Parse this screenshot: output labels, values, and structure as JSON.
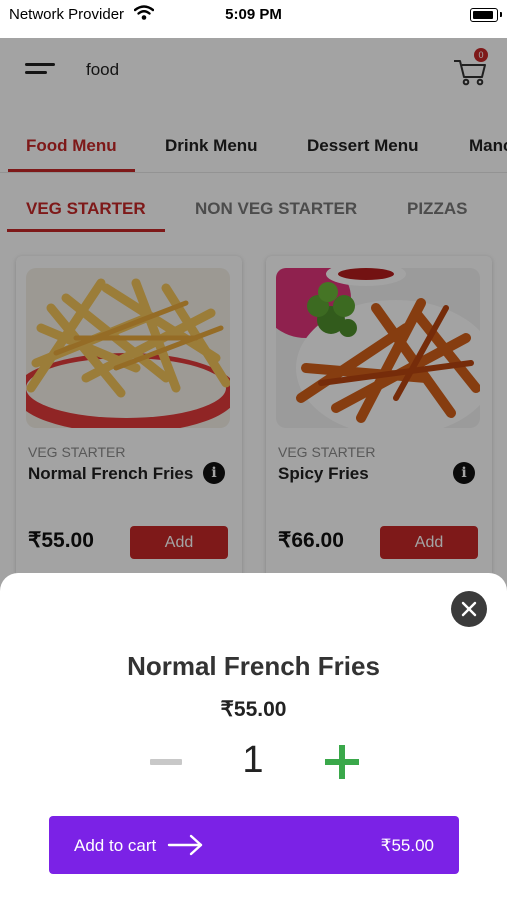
{
  "status_bar": {
    "carrier": "Network Provider",
    "time": "5:09 PM"
  },
  "header": {
    "search_text": "food",
    "cart_count": "0"
  },
  "menu_tabs": [
    {
      "label": "Food Menu",
      "active": true
    },
    {
      "label": "Drink Menu",
      "active": false
    },
    {
      "label": "Dessert Menu",
      "active": false
    },
    {
      "label": "Manc",
      "active": false
    }
  ],
  "category_tabs": [
    {
      "label": "VEG STARTER",
      "active": true
    },
    {
      "label": "NON VEG STARTER",
      "active": false
    },
    {
      "label": "PIZZAS",
      "active": false
    }
  ],
  "products": [
    {
      "category": "VEG STARTER",
      "name": "Normal French Fries",
      "price": "₹55.00",
      "add_label": "Add"
    },
    {
      "category": "VEG STARTER",
      "name": "Spicy Fries",
      "price": "₹66.00",
      "add_label": "Add"
    }
  ],
  "sheet": {
    "title": "Normal French Fries",
    "price": "₹55.00",
    "quantity": "1",
    "add_to_cart_label": "Add to cart",
    "total": "₹55.00"
  },
  "colors": {
    "accent_red": "#c62828",
    "purple": "#7b22e6",
    "plus_green": "#3aa84a"
  },
  "icons": [
    "wifi-icon",
    "battery-icon",
    "hamburger-menu-icon",
    "cart-icon",
    "info-icon",
    "close-icon",
    "minus-icon",
    "plus-icon",
    "arrow-right-icon"
  ]
}
